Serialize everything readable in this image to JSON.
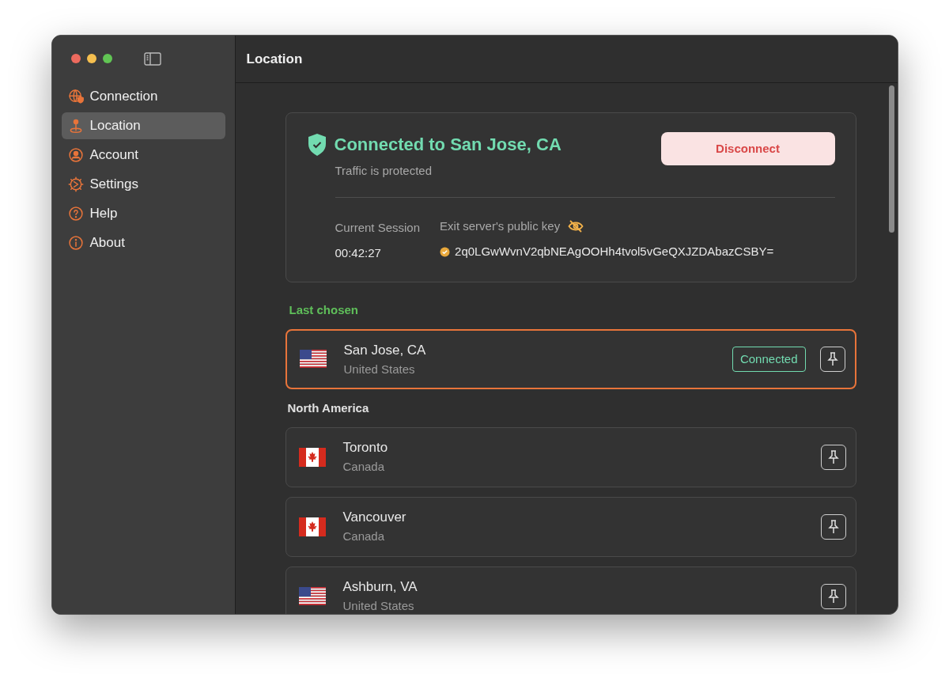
{
  "sidebar": {
    "items": [
      {
        "label": "Connection",
        "selected": false
      },
      {
        "label": "Location",
        "selected": true
      },
      {
        "label": "Account",
        "selected": false
      },
      {
        "label": "Settings",
        "selected": false
      },
      {
        "label": "Help",
        "selected": false
      },
      {
        "label": "About",
        "selected": false
      }
    ]
  },
  "header": {
    "title": "Location"
  },
  "status_card": {
    "title": "Connected to San Jose, CA",
    "subtitle": "Traffic is protected",
    "button": "Disconnect",
    "session_label": "Current Session",
    "session_value": "00:42:27",
    "key_label": "Exit server's public key",
    "key_value": "2q0LGwWvnV2qbNEAgOOHh4tvol5vGeQXJZDAbazCSBY="
  },
  "sections": [
    {
      "title": "Last chosen",
      "kind": "recent",
      "locations": [
        {
          "city": "San Jose, CA",
          "country": "United States",
          "kind": "us",
          "selected": true,
          "badge": "Connected"
        }
      ]
    },
    {
      "title": "North America",
      "kind": "region",
      "locations": [
        {
          "city": "Toronto",
          "country": "Canada",
          "kind": "ca",
          "selected": false
        },
        {
          "city": "Vancouver",
          "country": "Canada",
          "kind": "ca",
          "selected": false
        },
        {
          "city": "Ashburn, VA",
          "country": "United States",
          "kind": "us",
          "selected": false
        }
      ]
    }
  ]
}
